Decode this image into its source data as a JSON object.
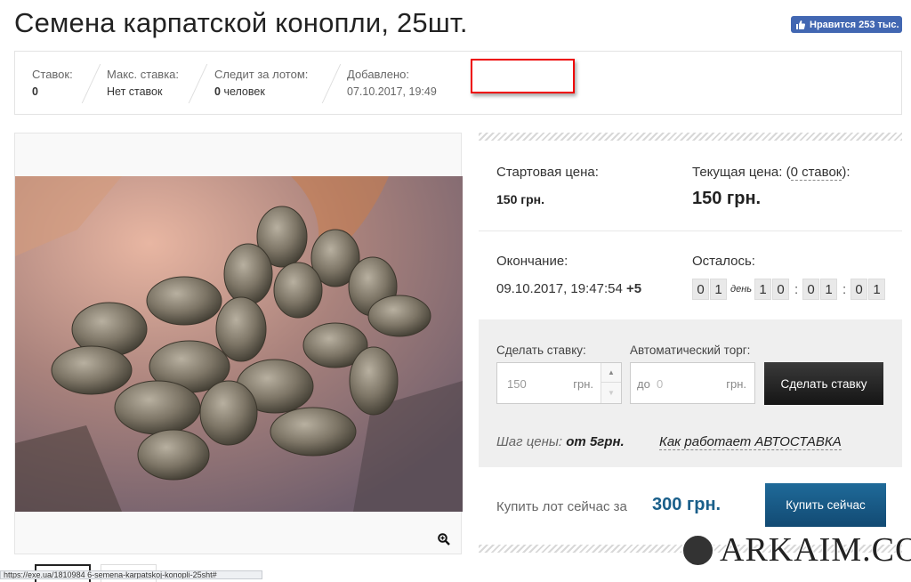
{
  "title": "Семена карпатской конопли, 25шт.",
  "fb": {
    "label": "Нравится 253 тыс.",
    "color": "#4267b2"
  },
  "info": [
    {
      "label": "Ставок:",
      "value": "0"
    },
    {
      "label": "Макс. ставка:",
      "value": "Нет ставок"
    },
    {
      "label": "Следит за лотом:",
      "value_bold": "0",
      "value": "человек"
    },
    {
      "label": "Добавлено:",
      "value": "07.10.2017, 19:49"
    }
  ],
  "prices": {
    "start_label": "Стартовая цена:",
    "start_value": "150 грн.",
    "current_label_a": "Текущая цена: (",
    "current_label_count": "0 ставок",
    "current_label_b": "):",
    "current_value": "150 грн."
  },
  "end": {
    "label": "Окончание:",
    "value": "09.10.2017, 19:47:54",
    "tz": "+5",
    "left_label": "Осталось:",
    "days": [
      "0",
      "1"
    ],
    "day_word": "день",
    "hours": [
      "1",
      "0"
    ],
    "minutes": [
      "0",
      "1"
    ],
    "seconds": [
      "0",
      "1"
    ],
    "sep": ":"
  },
  "bid": {
    "make_label": "Сделать ставку:",
    "value": "150",
    "unit": "грн.",
    "auto_label": "Автоматический торг:",
    "auto_prefix": "до",
    "auto_value": "0",
    "auto_unit": "грн.",
    "button": "Сделать ставку",
    "step_prefix": "Шаг цены:",
    "step_from": "от",
    "step_value": "5грн.",
    "auto_link": "Как работает АВТОСТАВКА"
  },
  "buy": {
    "label": "Купить лот сейчас за",
    "price": "300 грн.",
    "button": "Купить сейчас",
    "accent": "#1a5f8a"
  },
  "status_url": "https://exe.ua/1810984 6-semena-karpatskoj-konopli-25sht#",
  "watermark": "ARKAIM.CO"
}
